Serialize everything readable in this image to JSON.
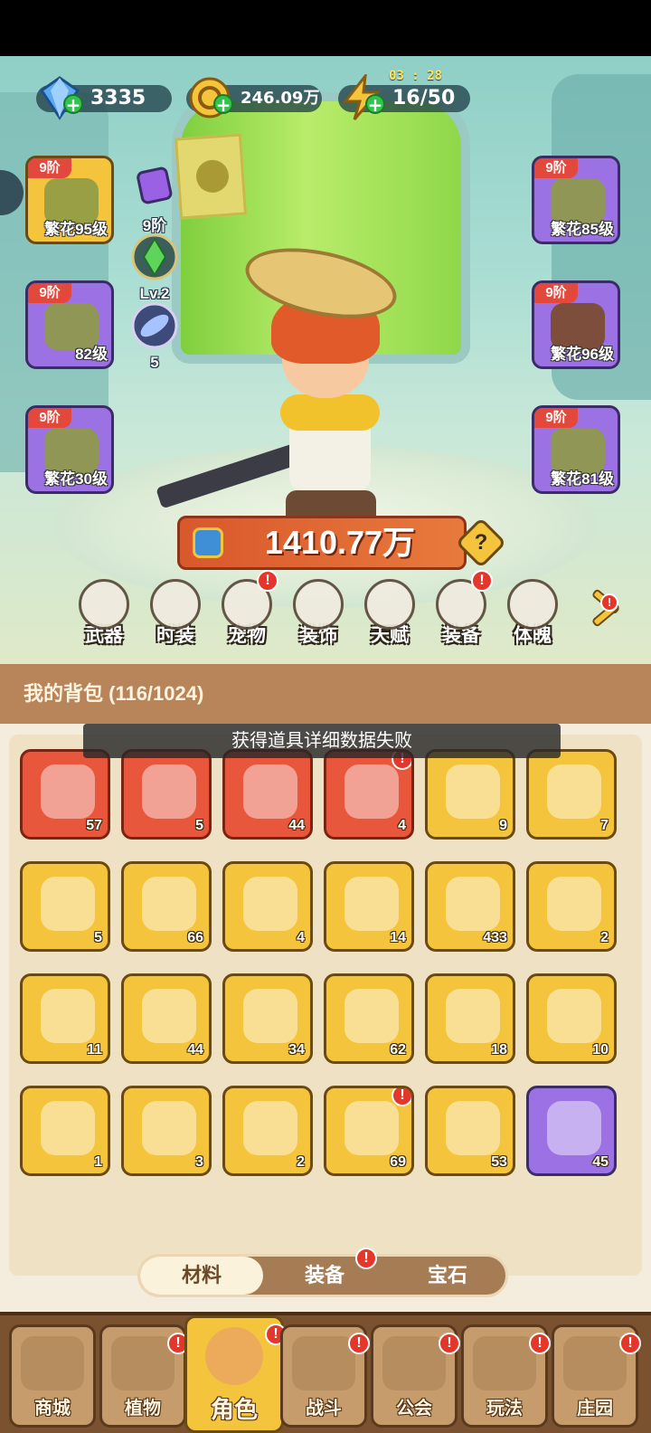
{
  "resources": {
    "diamonds": "3335",
    "gold": "246.09万",
    "energy": "16/50",
    "energy_timer": "03 : 28"
  },
  "equipment_left": [
    {
      "tier": "9阶",
      "level": "繁花95级",
      "slot": "hat",
      "frame": "gold"
    },
    {
      "tier": "9阶",
      "level": "82级",
      "slot": "gloves",
      "frame": "purple"
    },
    {
      "tier": "9阶",
      "level": "繁花30级",
      "slot": "pants",
      "frame": "purple"
    }
  ],
  "equipment_right": [
    {
      "tier": "9阶",
      "level": "繁花85级",
      "slot": "shirt",
      "frame": "purple"
    },
    {
      "tier": "9阶",
      "level": "繁花96级",
      "slot": "belt",
      "frame": "purple"
    },
    {
      "tier": "9阶",
      "level": "繁花81级",
      "slot": "boots",
      "frame": "purple"
    }
  ],
  "side_badges": [
    {
      "icon": "emblem-icon",
      "label": "9阶"
    },
    {
      "icon": "gem-icon",
      "label": "Lv.2"
    },
    {
      "icon": "orb-icon",
      "label": "5"
    }
  ],
  "power": "1410.77万",
  "help_glyph": "?",
  "character_tabs": [
    {
      "label": "武器",
      "alert": false
    },
    {
      "label": "时装",
      "alert": false
    },
    {
      "label": "宠物",
      "alert": true
    },
    {
      "label": "装饰",
      "alert": false
    },
    {
      "label": "天赋",
      "alert": false
    },
    {
      "label": "装备",
      "alert": true
    },
    {
      "label": "体魄",
      "alert": false
    }
  ],
  "alert_glyph": "!",
  "bag": {
    "title": "我的背包 (116/1024)",
    "toast": "获得道具详细数据失败",
    "items": [
      {
        "count": "57",
        "frame": "red",
        "icon": "crystal-star-icon"
      },
      {
        "count": "5",
        "frame": "red",
        "icon": "moon-star-icon"
      },
      {
        "count": "44",
        "frame": "red",
        "icon": "red-potion-icon"
      },
      {
        "count": "4",
        "frame": "red",
        "icon": "green-capsule-icon",
        "alert": true
      },
      {
        "count": "9",
        "frame": "gold",
        "icon": "water-drop-icon"
      },
      {
        "count": "7",
        "frame": "gold",
        "icon": "skull-scroll-icon"
      },
      {
        "count": "5",
        "frame": "gold",
        "icon": "key-icon"
      },
      {
        "count": "66",
        "frame": "gold",
        "icon": "pyramid-shard-icon"
      },
      {
        "count": "4",
        "frame": "gold",
        "icon": "golden-flower-icon"
      },
      {
        "count": "14",
        "frame": "gold",
        "icon": "rune-stone-icon"
      },
      {
        "count": "433",
        "frame": "gold",
        "icon": "orange-potion-icon"
      },
      {
        "count": "2",
        "frame": "gold",
        "icon": "glowing-ore-icon"
      },
      {
        "count": "11",
        "frame": "gold",
        "icon": "red-bud-icon"
      },
      {
        "count": "44",
        "frame": "gold",
        "icon": "flower-pot-icon"
      },
      {
        "count": "34",
        "frame": "gold",
        "icon": "sprayer-icon"
      },
      {
        "count": "62",
        "frame": "gold",
        "icon": "spell-book-icon"
      },
      {
        "count": "18",
        "frame": "gold",
        "icon": "jar-icon"
      },
      {
        "count": "10",
        "frame": "gold",
        "icon": "duck-puzzle-icon"
      },
      {
        "count": "1",
        "frame": "gold",
        "icon": "red-gem-icon"
      },
      {
        "count": "3",
        "frame": "gold",
        "icon": "crystal-flower-icon"
      },
      {
        "count": "2",
        "frame": "gold",
        "icon": "knot-icon"
      },
      {
        "count": "69",
        "frame": "gold",
        "icon": "mystery-potion-icon",
        "alert": true
      },
      {
        "count": "53",
        "frame": "gold",
        "icon": "flame-icon"
      },
      {
        "count": "45",
        "frame": "purple",
        "icon": "purple-potion-icon"
      }
    ]
  },
  "bag_tabs": [
    {
      "label": "材料",
      "active": true
    },
    {
      "label": "装备",
      "active": false,
      "alert": true
    },
    {
      "label": "宝石",
      "active": false
    }
  ],
  "bottom_nav": [
    {
      "label": "商城",
      "alert": false,
      "active": false
    },
    {
      "label": "植物",
      "alert": true,
      "active": false
    },
    {
      "label": "角色",
      "alert": true,
      "active": true
    },
    {
      "label": "战斗",
      "alert": true,
      "active": false
    },
    {
      "label": "公会",
      "alert": true,
      "active": false
    },
    {
      "label": "玩法",
      "alert": true,
      "active": false
    },
    {
      "label": "庄园",
      "alert": true,
      "active": false
    }
  ],
  "colors": {
    "gold_frame": "#f4c53c",
    "red_frame": "#e8573c",
    "purple_frame": "#9b71e4",
    "alert": "#e4372c"
  }
}
